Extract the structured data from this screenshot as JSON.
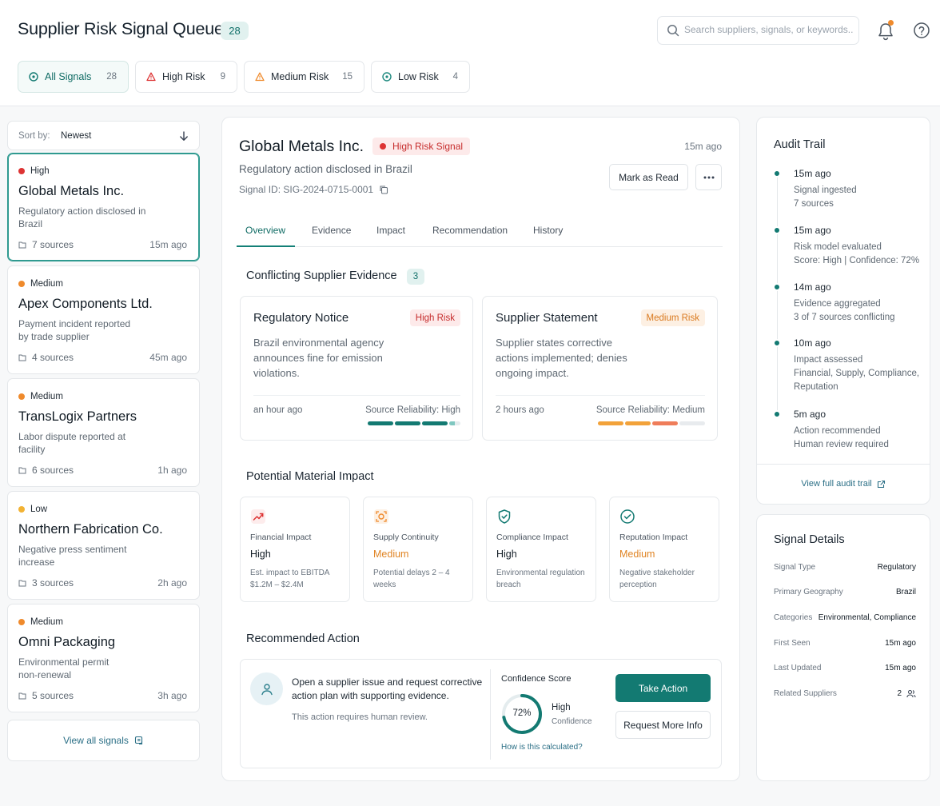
{
  "header": {
    "title": "Supplier Risk Signal Queue",
    "count": "28",
    "search_placeholder": "Search suppliers, signals, or keywords..."
  },
  "filters": [
    {
      "label": "All Signals",
      "count": "28",
      "icon": "info-circle-icon"
    },
    {
      "label": "High Risk",
      "count": "9",
      "icon": "warning-triangle-icon"
    },
    {
      "label": "Medium Risk",
      "count": "15",
      "icon": "warning-triangle-icon"
    },
    {
      "label": "Low Risk",
      "count": "4",
      "icon": "info-circle-icon"
    }
  ],
  "sort": {
    "label": "Sort by:",
    "value": "Newest"
  },
  "signals": [
    {
      "level": "High",
      "name": "Global Metals Inc.",
      "desc": "Regulatory action disclosed in Brazil",
      "sources": "7 sources",
      "time": "15m ago"
    },
    {
      "level": "Medium",
      "name": "Apex Components Ltd.",
      "desc": "Payment incident reported by trade supplier",
      "sources": "4 sources",
      "time": "45m ago"
    },
    {
      "level": "Medium",
      "name": "TransLogix Partners",
      "desc": "Labor dispute reported at facility",
      "sources": "6 sources",
      "time": "1h ago"
    },
    {
      "level": "Low",
      "name": "Northern Fabrication Co.",
      "desc": "Negative press sentiment increase",
      "sources": "3 sources",
      "time": "2h ago"
    },
    {
      "level": "Medium",
      "name": "Omni Packaging",
      "desc": "Environmental permit non-renewal",
      "sources": "5 sources",
      "time": "3h ago"
    }
  ],
  "view_all": "View all signals",
  "detail": {
    "name": "Global Metals Inc.",
    "badge": "High Risk Signal",
    "time": "15m ago",
    "subtitle": "Regulatory action disclosed in Brazil",
    "signal_id": "Signal ID: SIG-2024-0715-0001",
    "mark_read": "Mark as Read",
    "tabs": [
      "Overview",
      "Evidence",
      "Impact",
      "Recommendation",
      "History"
    ],
    "evidence_title": "Conflicting Supplier Evidence",
    "evidence_count": "3",
    "evidence": [
      {
        "title": "Regulatory Notice",
        "badge": "High Risk",
        "desc": "Brazil environmental agency announces fine for emission violations.",
        "ago": "an hour ago",
        "reliability": "Source Reliability: High"
      },
      {
        "title": "Supplier Statement",
        "badge": "Medium Risk",
        "desc": "Supplier states corrective actions implemented; denies ongoing impact.",
        "ago": "2 hours ago",
        "reliability": "Source Reliability: Medium"
      }
    ],
    "impact_title": "Potential Material Impact",
    "impacts": [
      {
        "title": "Financial Impact",
        "value": "High",
        "note": "Est. impact to EBITDA $1.2M – $2.4M"
      },
      {
        "title": "Supply Continuity",
        "value": "Medium",
        "note": "Potential delays 2 – 4 weeks"
      },
      {
        "title": "Compliance Impact",
        "value": "High",
        "note": "Environmental regulation breach"
      },
      {
        "title": "Reputation Impact",
        "value": "Medium",
        "note": "Negative stakeholder perception"
      }
    ],
    "rec_title": "Recommended Action",
    "rec_text": "Open a supplier issue and request corrective action plan with supporting evidence.",
    "rec_note": "This action requires human review.",
    "confidence_label": "Confidence Score",
    "confidence_value": 0.72,
    "confidence_pct": "72%",
    "confidence_level": "High",
    "confidence_sub": "Confidence",
    "how_calc": "How is this calculated?",
    "take_action": "Take Action",
    "request_info": "Request More Info"
  },
  "audit": {
    "title": "Audit Trail",
    "items": [
      {
        "time": "15m ago",
        "text": "Signal ingested\n7 sources"
      },
      {
        "time": "15m ago",
        "text": "Risk model evaluated\nScore: High | Confidence: 72%"
      },
      {
        "time": "14m ago",
        "text": "Evidence aggregated\n3 of 7 sources conflicting"
      },
      {
        "time": "10m ago",
        "text": "Impact assessed\nFinancial, Supply, Compliance, Reputation"
      },
      {
        "time": "5m ago",
        "text": "Action recommended\nHuman review required"
      }
    ],
    "view_full": "View full audit trail"
  },
  "details": {
    "title": "Signal Details",
    "rows": [
      {
        "k": "Signal Type",
        "v": "Regulatory"
      },
      {
        "k": "Primary Geography",
        "v": "Brazil"
      },
      {
        "k": "Categories",
        "v": "Environmental, Compliance"
      },
      {
        "k": "First Seen",
        "v": "15m ago"
      },
      {
        "k": "Last Updated",
        "v": "15m ago"
      },
      {
        "k": "Related Suppliers",
        "v": "2"
      }
    ]
  },
  "colors": {
    "accent": "#137a72",
    "high": "#dd3333",
    "medium": "#ef8a2c",
    "low": "#f2b233"
  }
}
